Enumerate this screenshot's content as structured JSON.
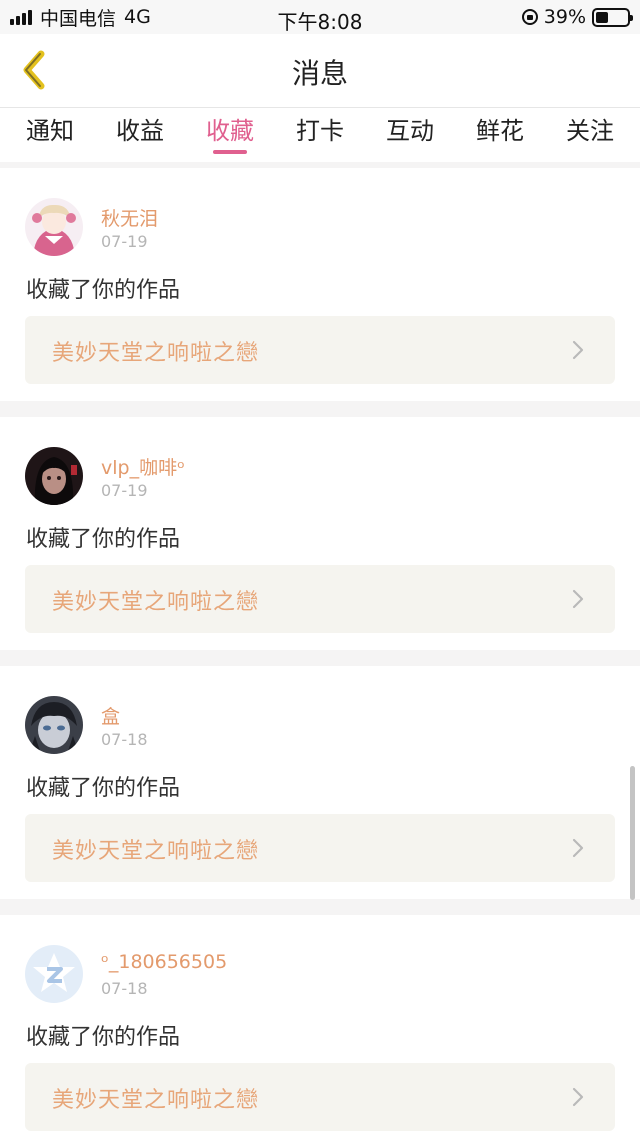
{
  "status_bar": {
    "carrier": "中国电信",
    "network": "4G",
    "time": "下午8:08",
    "battery_percent": "39%",
    "battery_level": 0.39
  },
  "nav": {
    "title": "消息",
    "back_icon": "chevron-left-icon"
  },
  "tabs": [
    {
      "label": "通知",
      "active": false
    },
    {
      "label": "收益",
      "active": false
    },
    {
      "label": "收藏",
      "active": true
    },
    {
      "label": "打卡",
      "active": false
    },
    {
      "label": "互动",
      "active": false
    },
    {
      "label": "鲜花",
      "active": false
    },
    {
      "label": "关注",
      "active": false
    }
  ],
  "items": [
    {
      "username": "秋无泪",
      "date": "07-19",
      "action": "收藏了你的作品",
      "work_title": "美妙天堂之响啦之戀",
      "avatar": "anime-girl-avatar"
    },
    {
      "username": "vlp_咖啡ᵒ",
      "date": "07-19",
      "action": "收藏了你的作品",
      "work_title": "美妙天堂之响啦之戀",
      "avatar": "dark-portrait-avatar"
    },
    {
      "username": "盒",
      "date": "07-18",
      "action": "收藏了你的作品",
      "work_title": "美妙天堂之响啦之戀",
      "avatar": "gothic-portrait-avatar"
    },
    {
      "username": "ᵒ_180656505",
      "date": "07-18",
      "action": "收藏了你的作品",
      "work_title": "美妙天堂之响啦之戀",
      "avatar": "default-qq-avatar"
    }
  ],
  "colors": {
    "accent_pink": "#e0608f",
    "username_orange": "#e39a6c",
    "work_title_orange": "#e7a679"
  }
}
